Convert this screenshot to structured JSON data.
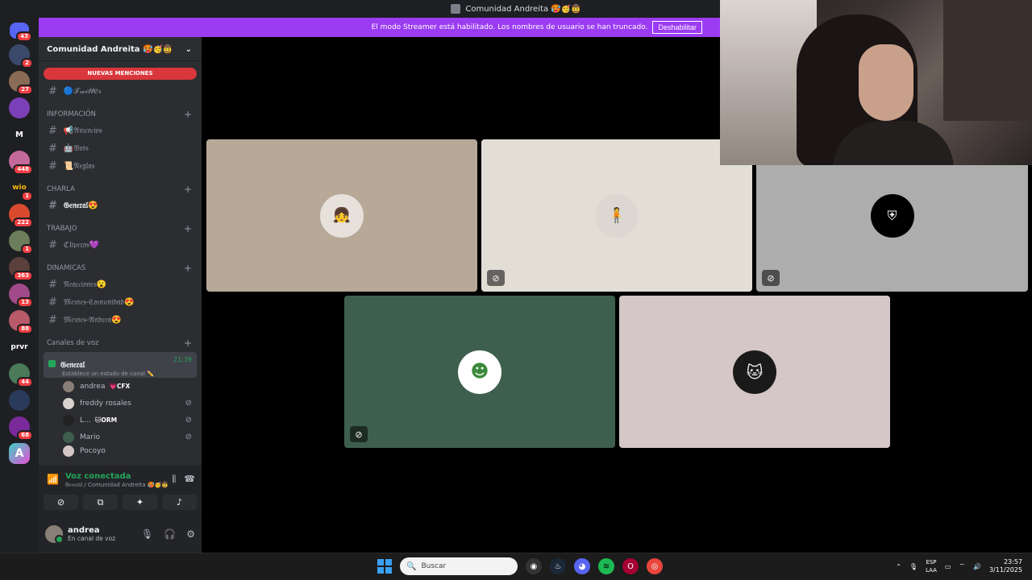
{
  "window": {
    "title": "Comunidad Andreita 🥵🥳🤠"
  },
  "streamer_bar": {
    "message": "El modo Streamer está habilitado. Los nombres de usuario se han truncado.",
    "disable_label": "Deshabilitar"
  },
  "server_rail": {
    "badges": [
      "43",
      "2",
      "27",
      "448",
      "1",
      "222",
      "1",
      "363",
      "13",
      "88",
      "44",
      "68"
    ],
    "letters": {
      "m": "M",
      "prvr": "prvr",
      "wio": "wio"
    }
  },
  "server": {
    "name": "Comunidad Andreita 🥵🥳🤠",
    "new_mentions": "NUEVAS MENCIONES",
    "channels": {
      "twitter": "🔵𝒯𝓌𝒾𝓉𝓉𝑒𝓇",
      "info_category": "INFORMACIÓN",
      "anuncios": "📢𝔄𝔫𝔲𝔫𝔠𝔦𝔬𝔰",
      "bots": "🤖𝔅𝔬𝔱𝔰",
      "reglas": "📜𝔑𝔢𝔤𝔩𝔞𝔰",
      "charla_category": "CHARLA",
      "general": "𝔊𝔢𝔫𝔢𝔯𝔞𝔩😍",
      "trabajo_category": "TRABAJO",
      "clipperos": "ℭ𝔩𝔦𝔭𝔢𝔯𝔬𝔰💜",
      "dinamicas_category": "DINAMICAS",
      "reacciones": "𝔑𝔢𝔞𝔠𝔠𝔦𝔬𝔫𝔢𝔰😮",
      "memes_comunidad": "𝔐𝔢𝔪𝔢𝔰-ℭ𝔬𝔪𝔲𝔫𝔦𝔡𝔞𝔡😍",
      "memes_andrea": "𝔐𝔢𝔪𝔢𝔰-𝔄𝔫𝔡𝔯𝔢𝔞😍",
      "voice_category": "Canales de voz"
    },
    "voice_channel": {
      "name": "𝔊𝔢𝔫𝔢𝔯𝔞𝔩",
      "status": "Establece un estado de canal ✏️",
      "time": "21:39",
      "users": [
        {
          "name": "andrea",
          "tag": "💗CFX"
        },
        {
          "name": "freddy rosales",
          "tag": ""
        },
        {
          "name": "L...",
          "tag": "🐱ORM"
        },
        {
          "name": "Mario",
          "tag": ""
        },
        {
          "name": "Pocoyo",
          "tag": ""
        }
      ]
    }
  },
  "voice_panel": {
    "title": "Voz conectada",
    "subtitle": "𝔊𝔢𝔫𝔢𝔯𝔞𝔩 / Comunidad Andreita 🥵🥳🤠"
  },
  "user_panel": {
    "name": "andrea",
    "status": "En canal de voz"
  },
  "taskbar": {
    "search_placeholder": "Buscar",
    "lang_top": "ESP",
    "lang_bottom": "LAA",
    "time": "23:57",
    "date": "3/11/2025"
  },
  "colors": {
    "streamer_bar": "#9b3cf2",
    "tile1": "#b8a898",
    "tile2": "#e2ded6",
    "tile3": "#adadad",
    "tile4": "#3e5f4e",
    "tile5": "#d5c6c8"
  }
}
